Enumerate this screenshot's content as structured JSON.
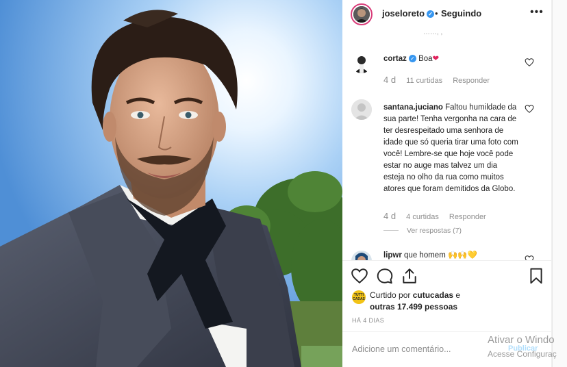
{
  "post": {
    "username": "joseloreto",
    "follow_separator": "•",
    "follow_status": "Seguindo",
    "more_glyph": "•••",
    "partial_top_text": "……, ,"
  },
  "comments": [
    {
      "username": "cortaz",
      "verified": true,
      "text": "Boa",
      "emoji": "❤",
      "age": "4 d",
      "likes": "11 curtidas",
      "reply": "Responder"
    },
    {
      "username": "santana.juciano",
      "verified": false,
      "text": "Faltou humildade da sua parte! Tenha vergonha na cara de ter desrespeitado uma senhora de idade que só queria tirar uma foto com você! Lembre-se que hoje você pode estar no auge mas talvez um dia esteja no olho da rua como muitos atores que foram demitidos da Globo.",
      "age": "4 d",
      "likes": "4 curtidas",
      "reply": "Responder",
      "view_replies": "Ver respostas (7)"
    },
    {
      "username": "lipwr",
      "text": "que homem 🙌🙌💛"
    }
  ],
  "likes": {
    "avatar_text": "TUTTI CADAS",
    "prefix": "Curtido por",
    "user": "cutucadas",
    "connector": "e",
    "others": "outras 17.499 pessoas"
  },
  "time_ago": "HÁ 4 DIAS",
  "add_comment": {
    "placeholder": "Adicione um comentário...",
    "publish": "Publicar"
  },
  "watermark": {
    "line1": "Ativar o Windo",
    "line2": "Acesse Configuraç"
  },
  "colors": {
    "accent_blue": "#3897f0",
    "heart_red": "#ed4956",
    "text_primary": "#262626",
    "text_secondary": "#8e8e8e"
  }
}
